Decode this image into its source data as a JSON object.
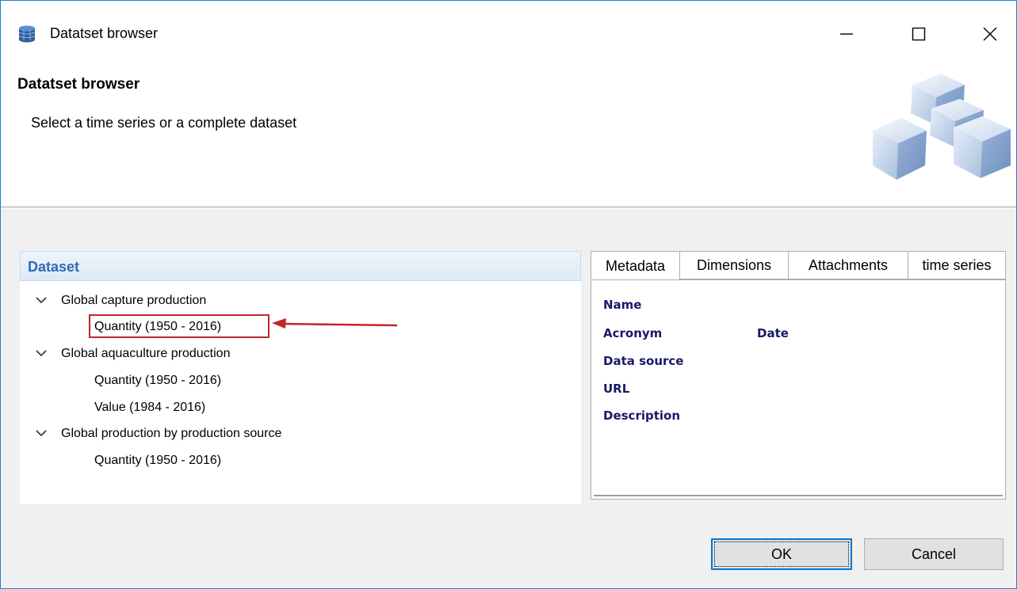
{
  "window": {
    "title": "Datatset browser",
    "icon": "database-icon",
    "controls": [
      "minimize-icon",
      "maximize-icon",
      "close-icon"
    ]
  },
  "banner": {
    "heading": "Datatset browser",
    "subtitle": "Select a time series or a complete dataset",
    "image": "cubes-image"
  },
  "dataset": {
    "header": "Dataset",
    "groups": [
      {
        "label": "Global capture production",
        "expanded": true,
        "items": [
          "Quantity (1950 - 2016)"
        ]
      },
      {
        "label": "Global aquaculture production",
        "expanded": true,
        "items": [
          "Quantity (1950 - 2016)",
          "Value (1984 - 2016)"
        ]
      },
      {
        "label": "Global production by production source",
        "expanded": true,
        "items": [
          "Quantity (1950 - 2016)"
        ]
      }
    ],
    "selected": "Quantity (1950 - 2016)"
  },
  "tabs": [
    "Metadata",
    "Dimensions",
    "Attachments",
    "time series"
  ],
  "active_tab": "Metadata",
  "metadata": {
    "name": "Name",
    "acronym": "Acronym",
    "date": "Date",
    "data_source": "Data source",
    "url": "URL",
    "description": "Description"
  },
  "buttons": {
    "ok": "OK",
    "cancel": "Cancel"
  },
  "colors": {
    "accent": "#0078d7",
    "highlight": "#c0262b",
    "header_text": "#2c6bb5",
    "meta_label": "#19196a"
  }
}
